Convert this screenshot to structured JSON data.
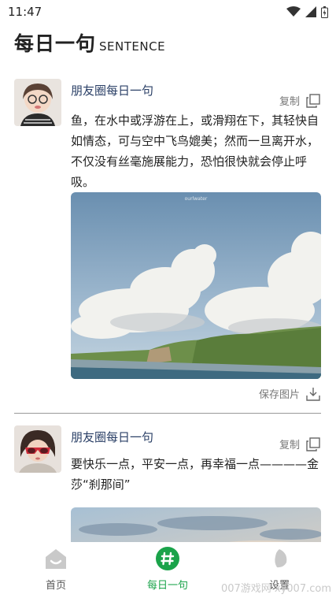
{
  "status_bar": {
    "time": "11:47"
  },
  "header": {
    "title": "每日一句",
    "subtitle": "SENTENCE"
  },
  "posts": [
    {
      "author": "朋友圈每日一句",
      "copy_label": "复制",
      "text": "鱼，在水中或浮游在上，或滑翔在下，其轻快自如情态，可与空中飞鸟媲美；然而一旦离开水，不仅没有丝毫施展能力，恐怕很快就会停止呼吸。",
      "photo_caption": "ourlwater",
      "save_label": "保存图片"
    },
    {
      "author": "朋友圈每日一句",
      "copy_label": "复制",
      "text": "要快乐一点，平安一点，再幸福一点————金莎“刹那间”"
    }
  ],
  "tabbar": {
    "home": "首页",
    "daily": "每日一句",
    "settings": "设置"
  },
  "watermark": "007游戏网 xy007.com",
  "colors": {
    "accent": "#1aa34a",
    "author": "#2a3f66"
  }
}
